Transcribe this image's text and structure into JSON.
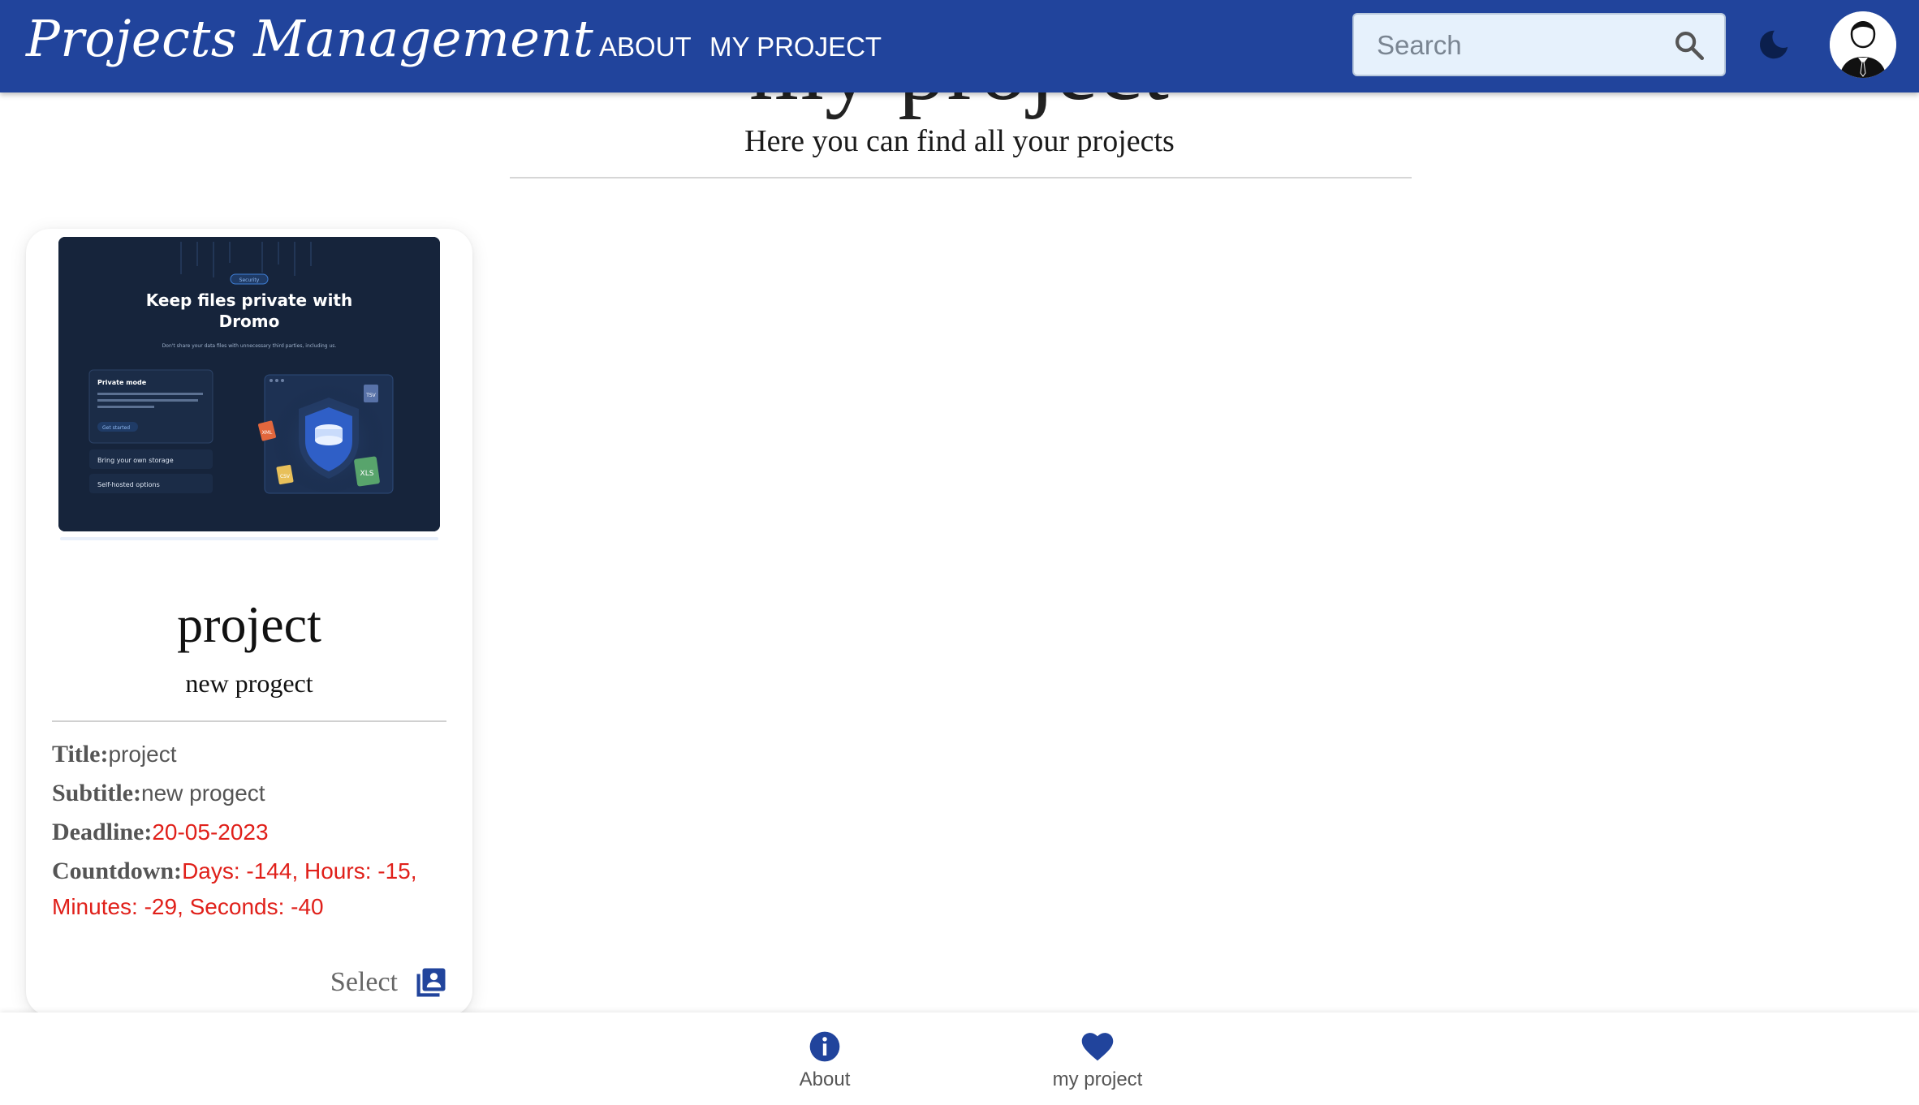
{
  "appbar": {
    "brand": "Projects Management",
    "nav": [
      {
        "label": "ABOUT"
      },
      {
        "label": "MY PROJECT"
      }
    ],
    "search": {
      "placeholder": "Search",
      "value": ""
    },
    "icons": {
      "search": "search-icon",
      "theme": "moon-icon",
      "avatar": "user-avatar"
    },
    "color": "#21449c"
  },
  "page": {
    "title": "my project",
    "subtitle": "Here you can find all your projects"
  },
  "card": {
    "thumbnail": {
      "badge": "Security",
      "heading_line1": "Keep files private with",
      "heading_line2": "Dromo",
      "tagline": "Don't share your data files with unnecessary third parties, including us.",
      "panel_title": "Private mode",
      "panel_text": "When in Private Mode, Dromo operates entirely in the context of the web browser, so we don't see your data files.",
      "panel_link": "Get started",
      "option1": "Bring your own storage",
      "option2": "Self-hosted options",
      "file_tags": [
        "TSV",
        "XML",
        "CSV",
        "XLS"
      ]
    },
    "title": "project",
    "subtitle": "new progect",
    "fields": {
      "title_label": "Title:",
      "title_value": "project",
      "subtitle_label": "Subtitle:",
      "subtitle_value": "new progect",
      "deadline_label": "Deadline:",
      "deadline_value": "20-05-2023",
      "countdown_label": "Countdown:",
      "countdown_value": "Days: -144, Hours: -15, Minutes: -29, Seconds: -40"
    },
    "select_label": "Select",
    "accent_red": "#e0201a"
  },
  "bottom_nav": [
    {
      "label": "About",
      "icon": "info-icon"
    },
    {
      "label": "my project",
      "icon": "heart-icon"
    }
  ]
}
